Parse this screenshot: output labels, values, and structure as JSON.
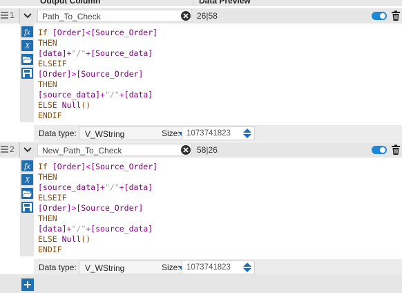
{
  "header": {
    "output_column": "Output Column",
    "data_preview": "Data Preview"
  },
  "rows": [
    {
      "index": "1",
      "name": "Path_To_Check",
      "preview": "26|58",
      "enabled": true,
      "expression": [
        [
          [
            "k",
            "If "
          ],
          [
            "f",
            "[Order]"
          ],
          [
            "p",
            "<"
          ],
          [
            "f",
            "[Source_Order]"
          ]
        ],
        [
          [
            "k",
            "THEN"
          ]
        ],
        [
          [
            "f",
            "[data]"
          ],
          [
            "p",
            "+"
          ],
          [
            "s",
            "\"/\""
          ],
          [
            "p",
            "+"
          ],
          [
            "f",
            "[Source_data]"
          ]
        ],
        [
          [
            "k",
            "ELSEIF"
          ]
        ],
        [
          [
            "f",
            "[Order]"
          ],
          [
            "p",
            ">"
          ],
          [
            "f",
            "[Source_Order]"
          ]
        ],
        [
          [
            "k",
            "THEN"
          ]
        ],
        [
          [
            "f",
            "[source_data]"
          ],
          [
            "p",
            "+"
          ],
          [
            "s",
            "\"/\""
          ],
          [
            "p",
            "+"
          ],
          [
            "f",
            "[data]"
          ]
        ],
        [
          [
            "k",
            "ELSE "
          ],
          [
            "f",
            "Null"
          ],
          [
            "k",
            "()"
          ]
        ],
        [
          [
            "k",
            "ENDIF"
          ]
        ]
      ],
      "data_type_label": "Data type:",
      "data_type": "V_WString",
      "size_label": "Size:",
      "size": "1073741823"
    },
    {
      "index": "2",
      "name": "New_Path_To_Check",
      "preview": "58|26",
      "enabled": true,
      "expression": [
        [
          [
            "k",
            "If "
          ],
          [
            "f",
            "[Order]"
          ],
          [
            "p",
            "<"
          ],
          [
            "f",
            "[Source_Order]"
          ]
        ],
        [
          [
            "k",
            "THEN"
          ]
        ],
        [
          [
            "f",
            "[source_data]"
          ],
          [
            "p",
            "+"
          ],
          [
            "s",
            "\"/\""
          ],
          [
            "p",
            "+"
          ],
          [
            "f",
            "[data]"
          ]
        ],
        [
          [
            "k",
            "ELSEIF"
          ]
        ],
        [
          [
            "f",
            "[Order]"
          ],
          [
            "p",
            ">"
          ],
          [
            "f",
            "[Source_Order]"
          ]
        ],
        [
          [
            "k",
            "THEN"
          ]
        ],
        [
          [
            "f",
            "[data]"
          ],
          [
            "p",
            "+"
          ],
          [
            "s",
            "\"/\""
          ],
          [
            "p",
            "+"
          ],
          [
            "f",
            "[source_data]"
          ]
        ],
        [
          [
            "k",
            "ELSE "
          ],
          [
            "f",
            "Null"
          ],
          [
            "k",
            "()"
          ]
        ],
        [
          [
            "k",
            "ENDIF"
          ]
        ]
      ],
      "data_type_label": "Data type:",
      "data_type": "V_WString",
      "size_label": "Size:",
      "size": "1073741823"
    }
  ],
  "tool_icons": [
    "fx-function-icon",
    "x-variable-icon",
    "folder-open-icon",
    "save-icon"
  ],
  "colors": {
    "accent": "#1f6fb5",
    "toggle_on": "#1f87d6",
    "keyword": "#8b4a0a",
    "field": "#800080",
    "operator": "#d200d2",
    "string": "#a0a0a0"
  }
}
